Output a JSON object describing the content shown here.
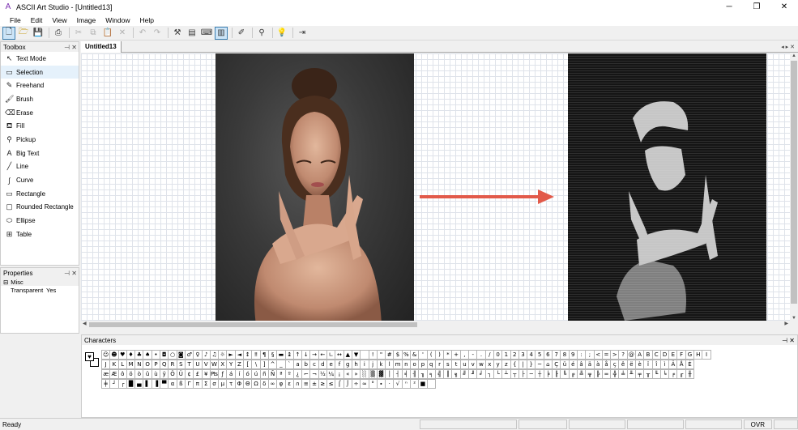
{
  "window": {
    "title": "ASCII Art Studio - [Untitled13]",
    "minimize_glyph": "─",
    "maximize_glyph": "❐",
    "close_glyph": "✕"
  },
  "menu": [
    "File",
    "Edit",
    "View",
    "Image",
    "Window",
    "Help"
  ],
  "toolbar": {
    "buttons": [
      "new-file-icon",
      "open-folder-icon",
      "save-icon",
      "print-icon",
      "cut-icon",
      "copy-icon",
      "paste-icon",
      "delete-icon",
      "undo-icon",
      "redo-icon",
      "tools-icon",
      "image-tool-icon",
      "keyboard-icon",
      "panel-toggle-icon",
      "eyedropper-icon",
      "zoom-icon",
      "help-icon",
      "exit-icon"
    ]
  },
  "toolbox": {
    "title": "Toolbox",
    "tools": [
      {
        "label": "Text Mode",
        "icon": "cursor-icon",
        "glyph": "↖"
      },
      {
        "label": "Selection",
        "icon": "selection-icon",
        "glyph": "▭"
      },
      {
        "label": "Freehand",
        "icon": "pencil-icon",
        "glyph": "✎"
      },
      {
        "label": "Brush",
        "icon": "brush-icon",
        "glyph": "🖌"
      },
      {
        "label": "Erase",
        "icon": "eraser-icon",
        "glyph": "⌫"
      },
      {
        "label": "Fill",
        "icon": "fill-bucket-icon",
        "glyph": "⛾"
      },
      {
        "label": "Pickup",
        "icon": "pipette-icon",
        "glyph": "⚲"
      },
      {
        "label": "Big Text",
        "icon": "big-text-icon",
        "glyph": "A"
      },
      {
        "label": "Line",
        "icon": "line-icon",
        "glyph": "╱"
      },
      {
        "label": "Curve",
        "icon": "curve-icon",
        "glyph": "∫"
      },
      {
        "label": "Rectangle",
        "icon": "rectangle-icon",
        "glyph": "▭"
      },
      {
        "label": "Rounded Rectangle",
        "icon": "rounded-rectangle-icon",
        "glyph": "▢"
      },
      {
        "label": "Ellipse",
        "icon": "ellipse-icon",
        "glyph": "⬭"
      },
      {
        "label": "Table",
        "icon": "table-icon",
        "glyph": "⊞"
      }
    ]
  },
  "properties": {
    "title": "Properties",
    "category": "Misc",
    "rows": [
      {
        "name": "Transparent",
        "value": "Yes"
      }
    ]
  },
  "panel_buttons": "⊣ ✕",
  "document": {
    "tab": "Untitled13",
    "nav": "◂ ▸ ✕"
  },
  "characters": {
    "title": "Characters",
    "current": "♥",
    "rows": [
      [
        "☺",
        "☻",
        "♥",
        "♦",
        "♣",
        "♠",
        "•",
        "◘",
        "○",
        "◙",
        "♂",
        "♀",
        "♪",
        "♫",
        "☼",
        "►",
        "◄",
        "↕",
        "‼",
        "¶",
        "§",
        "▬",
        "↨",
        "↑",
        "↓",
        "→",
        "←",
        "∟",
        "↔",
        "▲",
        "▼",
        " ",
        "!",
        "\"",
        "#",
        "$",
        "%",
        "&",
        "'",
        "(",
        ")",
        "*",
        "+",
        ",",
        "-",
        ".",
        "/",
        "0",
        "1",
        "2",
        "3",
        "4",
        "5",
        "6",
        "7",
        "8",
        "9",
        ":",
        ";",
        "<",
        "=",
        ">",
        "?",
        "@",
        "A",
        "B",
        "C",
        "D",
        "E",
        "F",
        "G",
        "H",
        "I"
      ],
      [
        "J",
        "K",
        "L",
        "M",
        "N",
        "O",
        "P",
        "Q",
        "R",
        "S",
        "T",
        "U",
        "V",
        "W",
        "X",
        "Y",
        "Z",
        "[",
        "\\",
        "]",
        "^",
        "_",
        "`",
        "a",
        "b",
        "c",
        "d",
        "e",
        "f",
        "g",
        "h",
        "i",
        "j",
        "k",
        "l",
        "m",
        "n",
        "o",
        "p",
        "q",
        "r",
        "s",
        "t",
        "u",
        "v",
        "w",
        "x",
        "y",
        "z",
        "{",
        "|",
        "}",
        "~",
        "⌂",
        "Ç",
        "ü",
        "é",
        "â",
        "ä",
        "à",
        "å",
        "ç",
        "ê",
        "ë",
        "è",
        "ï",
        "î",
        "ì",
        "Ä",
        "Å",
        "É"
      ],
      [
        "æ",
        "Æ",
        "ô",
        "ö",
        "ò",
        "û",
        "ù",
        "ÿ",
        "Ö",
        "Ü",
        "¢",
        "£",
        "¥",
        "₧",
        "ƒ",
        "á",
        "í",
        "ó",
        "ú",
        "ñ",
        "Ñ",
        "ª",
        "º",
        "¿",
        "⌐",
        "¬",
        "½",
        "¼",
        "¡",
        "«",
        "»",
        "░",
        "▒",
        "▓",
        "│",
        "┤",
        "╡",
        "╢",
        "╖",
        "╕",
        "╣",
        "║",
        "╗",
        "╝",
        "╜",
        "╛",
        "┐",
        "└",
        "┴",
        "┬",
        "├",
        "─",
        "┼",
        "╞",
        "╟",
        "╚",
        "╔",
        "╩",
        "╦",
        "╠",
        "═",
        "╬",
        "╧",
        "╨",
        "╤",
        "╥",
        "╙",
        "╘",
        "╒",
        "╓",
        "╫"
      ],
      [
        "╪",
        "┘",
        "┌",
        "█",
        "▄",
        "▌",
        "▐",
        "▀",
        "α",
        "ß",
        "Γ",
        "π",
        "Σ",
        "σ",
        "µ",
        "τ",
        "Φ",
        "Θ",
        "Ω",
        "δ",
        "∞",
        "φ",
        "ε",
        "∩",
        "≡",
        "±",
        "≥",
        "≤",
        "⌠",
        "⌡",
        "÷",
        "≈",
        "°",
        "∙",
        "·",
        "√",
        "ⁿ",
        "²",
        "■",
        " "
      ]
    ]
  },
  "status": {
    "left": "Ready",
    "mode": "OVR"
  }
}
